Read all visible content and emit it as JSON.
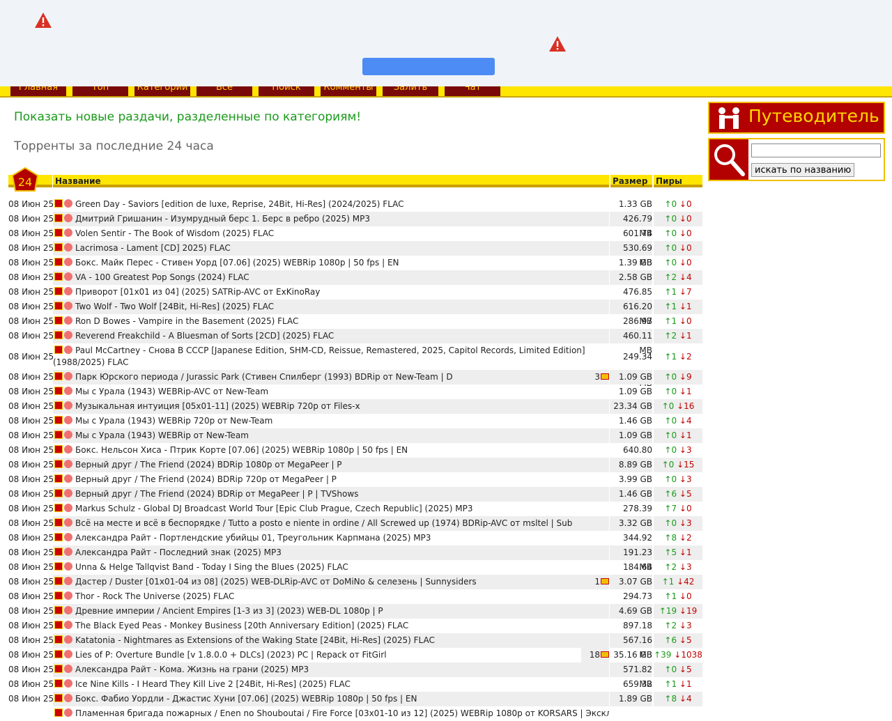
{
  "nav": [
    "Главная",
    "Топ",
    "Категории",
    "Все",
    "Поиск",
    "Комменты",
    "Залить",
    "Чат"
  ],
  "show_new_link": "Показать новые раздачи, разделенные по категориям!",
  "heading": "Торренты за последние 24 часа",
  "badge": "24",
  "columns": {
    "name": "Название",
    "size": "Размер",
    "peers": "Пиры"
  },
  "guide_label": "Путеводитель",
  "search_button": "искать по названию",
  "search_value": "",
  "rows": [
    {
      "date": "08 Июн 25",
      "name": "Green Day - Saviors [edition de luxe, Reprise, 24Bit, Hi-Res] (2024/2025) FLAC",
      "comments": "",
      "size": "1.33 GB",
      "seed": "0",
      "leech": "0"
    },
    {
      "date": "08 Июн 25",
      "name": "Дмитрий Гришанин - Изумрудный берс 1. Берс в ребро (2025) MP3",
      "comments": "",
      "size": "426.79 MB",
      "seed": "0",
      "leech": "0"
    },
    {
      "date": "08 Июн 25",
      "name": "Volen Sentir - The Book of Wisdom (2025) FLAC",
      "comments": "",
      "size": "601.74 MB",
      "seed": "0",
      "leech": "0"
    },
    {
      "date": "08 Июн 25",
      "name": "Lacrimosa - Lament [CD] 2025) FLAC",
      "comments": "",
      "size": "530.69 MB",
      "seed": "0",
      "leech": "0"
    },
    {
      "date": "08 Июн 25",
      "name": "Бокс. Майк Перес - Стивен Уорд [07.06] (2025) WEBRip 1080p | 50 fps | EN",
      "comments": "",
      "size": "1.39 GB",
      "seed": "0",
      "leech": "0"
    },
    {
      "date": "08 Июн 25",
      "name": "VA - 100 Greatest Pop Songs (2024) FLAC",
      "comments": "",
      "size": "2.58 GB",
      "seed": "2",
      "leech": "4"
    },
    {
      "date": "08 Июн 25",
      "name": "Приворот [01x01 из 04] (2025) SATRip-AVC от ExKinoRay",
      "comments": "",
      "size": "476.85 MB",
      "seed": "1",
      "leech": "7"
    },
    {
      "date": "08 Июн 25",
      "name": "Two Wolf - Two Wolf [24Bit, Hi-Res] (2025) FLAC",
      "comments": "",
      "size": "616.20 MB",
      "seed": "1",
      "leech": "1"
    },
    {
      "date": "08 Июн 25",
      "name": "Ron D Bowes - Vampire in the Basement (2025) FLAC",
      "comments": "",
      "size": "286.97 MB",
      "seed": "1",
      "leech": "0"
    },
    {
      "date": "08 Июн 25",
      "name": "Reverend Freakchild - A Bluesman of Sorts [2CD] (2025) FLAC",
      "comments": "",
      "size": "460.11 MB",
      "seed": "2",
      "leech": "1"
    },
    {
      "date": "08 Июн 25",
      "name": "Paul McCartney - Снова В СССР [Japanese Edition, SHM-CD, Reissue, Remastered, 2025, Capitol Records, Limited Edition] (1988/2025) FLAC",
      "comments": "",
      "size": "249.34 MB",
      "seed": "1",
      "leech": "2",
      "tall": true
    },
    {
      "date": "08 Июн 25",
      "name": "Парк Юрского периода / Jurassic Park (Стивен Спилберг (1993) BDRip от New-Team | D",
      "comments": "3",
      "size": "1.09 GB",
      "seed": "0",
      "leech": "9"
    },
    {
      "date": "08 Июн 25",
      "name": "Мы с Урала (1943) WEBRip-AVC от New-Team",
      "comments": "",
      "size": "1.09 GB",
      "seed": "0",
      "leech": "1"
    },
    {
      "date": "08 Июн 25",
      "name": "Музыкальная интуиция [05x01-11] (2025) WEBRip 720p от Files-x",
      "comments": "",
      "size": "23.34 GB",
      "seed": "0",
      "leech": "16"
    },
    {
      "date": "08 Июн 25",
      "name": "Мы с Урала (1943) WEBRip 720p от New-Team",
      "comments": "",
      "size": "1.46 GB",
      "seed": "0",
      "leech": "4"
    },
    {
      "date": "08 Июн 25",
      "name": "Мы с Урала (1943) WEBRip от New-Team",
      "comments": "",
      "size": "1.09 GB",
      "seed": "0",
      "leech": "1"
    },
    {
      "date": "08 Июн 25",
      "name": "Бокс. Нельсон Хиса - Птрик Корте [07.06] (2025) WEBRip 1080p | 50 fps | EN",
      "comments": "",
      "size": "640.80 MB",
      "seed": "0",
      "leech": "3"
    },
    {
      "date": "08 Июн 25",
      "name": "Верный друг / The Friend (2024) BDRip 1080p от MegaPeer | P",
      "comments": "",
      "size": "8.89 GB",
      "seed": "0",
      "leech": "15"
    },
    {
      "date": "08 Июн 25",
      "name": "Верный друг / The Friend (2024) BDRip 720p от MegaPeer | P",
      "comments": "",
      "size": "3.99 GB",
      "seed": "0",
      "leech": "3"
    },
    {
      "date": "08 Июн 25",
      "name": "Верный друг / The Friend (2024) BDRip от MegaPeer | P | TVShows",
      "comments": "",
      "size": "1.46 GB",
      "seed": "6",
      "leech": "5"
    },
    {
      "date": "08 Июн 25",
      "name": "Markus Schulz - Global DJ Broadcast World Tour [Epic Club Prague, Czech Republic] (2025) MP3",
      "comments": "",
      "size": "278.39 MB",
      "seed": "7",
      "leech": "0"
    },
    {
      "date": "08 Июн 25",
      "name": "Всё на месте и всё в беспорядке / Tutto a posto e niente in ordine / All Screwed up (1974) BDRip-AVC от msltel | Sub",
      "comments": "",
      "size": "3.32 GB",
      "seed": "0",
      "leech": "3"
    },
    {
      "date": "08 Июн 25",
      "name": "Александра Райт - Портлендские убийцы 01, Треугольник Карпмана (2025) MP3",
      "comments": "",
      "size": "344.92 MB",
      "seed": "8",
      "leech": "2"
    },
    {
      "date": "08 Июн 25",
      "name": "Александра Райт - Последний знак (2025) MP3",
      "comments": "",
      "size": "191.23 MB",
      "seed": "5",
      "leech": "1"
    },
    {
      "date": "08 Июн 25",
      "name": "Unna & Helge Tallqvist Band - Today I Sing the Blues (2025) FLAC",
      "comments": "",
      "size": "184.64 MB",
      "seed": "2",
      "leech": "3"
    },
    {
      "date": "08 Июн 25",
      "name": "Дастер / Duster [01x01-04 из 08] (2025) WEB-DLRip-AVC от DoMiNo & селезень | Sunnysiders",
      "comments": "1",
      "size": "3.07 GB",
      "seed": "1",
      "leech": "42"
    },
    {
      "date": "08 Июн 25",
      "name": "Thor - Rock The Universe (2025) FLAC",
      "comments": "",
      "size": "294.73 MB",
      "seed": "1",
      "leech": "0"
    },
    {
      "date": "08 Июн 25",
      "name": "Древние империи / Ancient Empires [1-3 из 3] (2023) WEB-DL 1080p | P",
      "comments": "",
      "size": "4.69 GB",
      "seed": "19",
      "leech": "19"
    },
    {
      "date": "08 Июн 25",
      "name": "The Black Eyed Peas - Monkey Business [20th Anniversary Edition] (2025) FLAC",
      "comments": "",
      "size": "897.18 MB",
      "seed": "2",
      "leech": "3"
    },
    {
      "date": "08 Июн 25",
      "name": "Katatonia - Nightmares as Extensions of the Waking State [24Bit, Hi-Res] (2025) FLAC",
      "comments": "",
      "size": "567.16 MB",
      "seed": "6",
      "leech": "5"
    },
    {
      "date": "08 Июн 25",
      "name": "Lies of P: Overture Bundle [v 1.8.0.0 + DLCs] (2023) PC | Repack от FitGirl",
      "comments": "18",
      "size": "35.16 GB",
      "seed": "39",
      "leech": "1038"
    },
    {
      "date": "08 Июн 25",
      "name": "Александра Райт - Кома. Жизнь на грани (2025) MP3",
      "comments": "",
      "size": "571.82 MB",
      "seed": "0",
      "leech": "5"
    },
    {
      "date": "08 Июн 25",
      "name": "Ice Nine Kills - I Heard They Kill Live 2 [24Bit, Hi-Res] (2025) FLAC",
      "comments": "",
      "size": "659.32 MB",
      "seed": "1",
      "leech": "1"
    },
    {
      "date": "08 Июн 25",
      "name": "Бокс. Фабио Уордли - Джастис Хуни [07.06] (2025) WEBRip 1080p | 50 fps | EN",
      "comments": "",
      "size": "1.89 GB",
      "seed": "8",
      "leech": "4"
    },
    {
      "date": "",
      "name": "Пламенная бригада пожарных / Enen no Shouboutai / Fire Force [03x01-10 из 12] (2025) WEBRip 1080p от KORSARS | Эксклюзивный",
      "comments": "",
      "size": "",
      "seed": "",
      "leech": ""
    }
  ]
}
